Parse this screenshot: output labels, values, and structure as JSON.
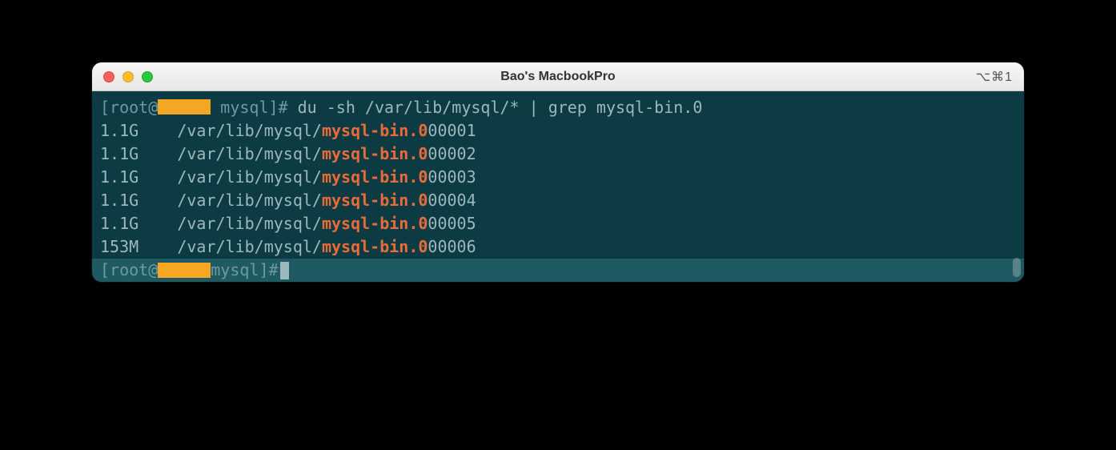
{
  "window": {
    "title": "Bao's MacbookPro",
    "shortcut": "⌥⌘1"
  },
  "prompt": {
    "user": "root",
    "at": "@",
    "dir": " mysql",
    "end": "]# "
  },
  "command": "du -sh /var/lib/mysql/* | grep mysql-bin.0",
  "rows": [
    {
      "size": "1.1G",
      "path_prefix": "/var/lib/mysql/",
      "match": "mysql-bin.0",
      "suffix": "00001"
    },
    {
      "size": "1.1G",
      "path_prefix": "/var/lib/mysql/",
      "match": "mysql-bin.0",
      "suffix": "00002"
    },
    {
      "size": "1.1G",
      "path_prefix": "/var/lib/mysql/",
      "match": "mysql-bin.0",
      "suffix": "00003"
    },
    {
      "size": "1.1G",
      "path_prefix": "/var/lib/mysql/",
      "match": "mysql-bin.0",
      "suffix": "00004"
    },
    {
      "size": "1.1G",
      "path_prefix": "/var/lib/mysql/",
      "match": "mysql-bin.0",
      "suffix": "00005"
    },
    {
      "size": "153M",
      "path_prefix": "/var/lib/mysql/",
      "match": "mysql-bin.0",
      "suffix": "00006"
    }
  ]
}
